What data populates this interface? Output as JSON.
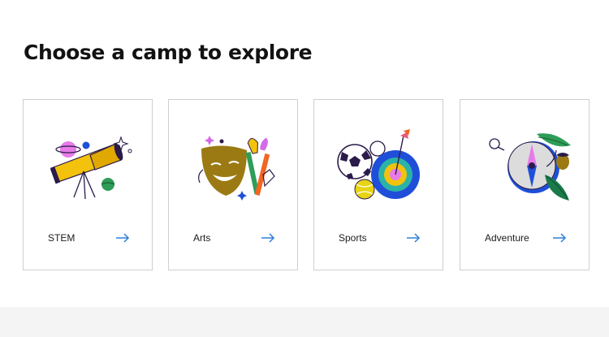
{
  "page": {
    "title": "Choose a camp to explore"
  },
  "camps": [
    {
      "label": "STEM",
      "illustration": "telescope-planets-icon"
    },
    {
      "label": "Arts",
      "illustration": "theater-mask-brushes-icon"
    },
    {
      "label": "Sports",
      "illustration": "soccer-ball-target-icon"
    },
    {
      "label": "Adventure",
      "illustration": "compass-leaves-icon"
    }
  ],
  "colors": {
    "accent_arrow": "#2f7fd8",
    "card_border": "#cfcfcf",
    "footer_band": "#f4f4f4",
    "title_text": "#121212"
  }
}
